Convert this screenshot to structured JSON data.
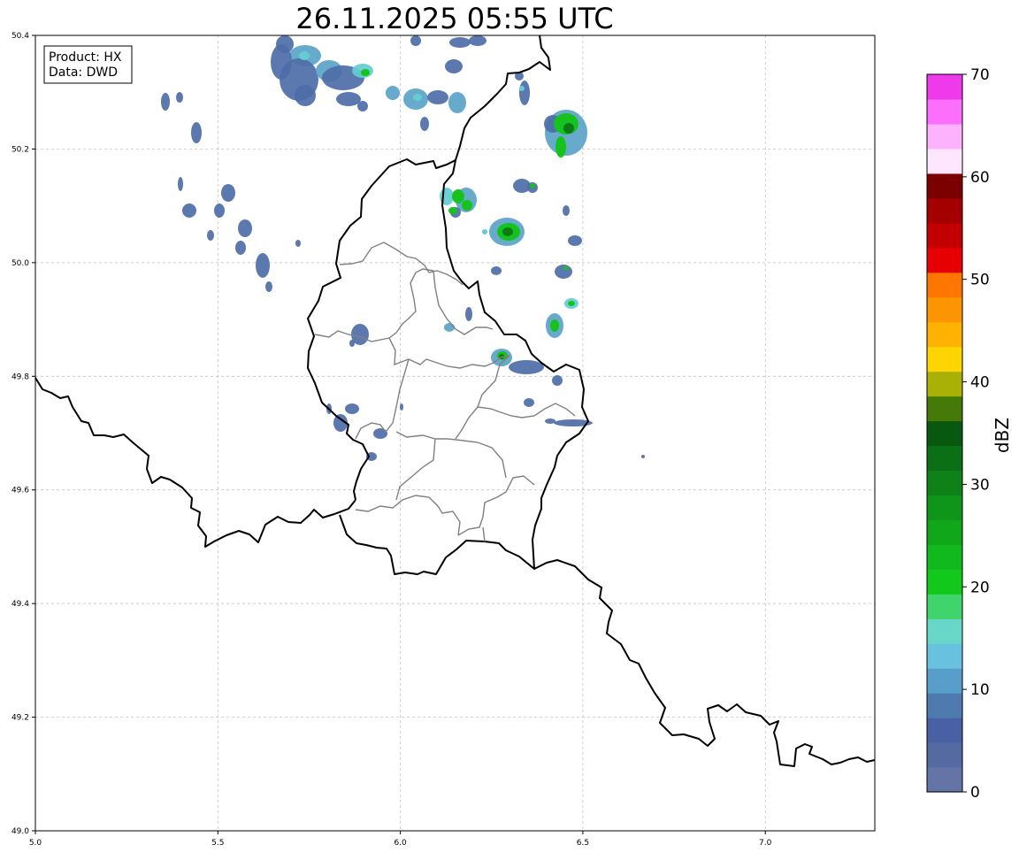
{
  "title": "26.11.2025 05:55 UTC",
  "info": {
    "product": "Product: HX",
    "source": "Data: DWD"
  },
  "x_ticks": [
    "5.0",
    "5.5",
    "6.0",
    "6.5",
    "7.0"
  ],
  "y_ticks": [
    "50.4",
    "50.2",
    "50.0",
    "49.8",
    "49.6",
    "49.4",
    "49.2",
    "49.0"
  ],
  "colorbar": {
    "label": "dBZ",
    "ticks": [
      "0",
      "10",
      "20",
      "30",
      "40",
      "50",
      "60",
      "70"
    ],
    "colors": [
      "#6474a6",
      "#566aa2",
      "#4961a4",
      "#4e7ab0",
      "#579fca",
      "#67c1df",
      "#68d7c9",
      "#3fd46c",
      "#12c91b",
      "#10b91c",
      "#10a81a",
      "#0f951a",
      "#0e8218",
      "#0b7015",
      "#085810",
      "#457a08",
      "#aab106",
      "#fed502",
      "#fdb202",
      "#fc9502",
      "#fd7700",
      "#e60003",
      "#c20001",
      "#a50000",
      "#7b0000",
      "#fde6fe",
      "#fcb2fd",
      "#fc6ffd",
      "#ee3aeb"
    ]
  },
  "map": {
    "lon_range": [
      5.0,
      7.3
    ],
    "lat_range": [
      49.0,
      50.4
    ],
    "grid": true,
    "radar_colors": {
      "weak": "#4e6ea8",
      "light": "#5aa3c8",
      "cyan": "#63cdd1",
      "green": "#16c21d",
      "dark_green": "#0d7a18"
    }
  }
}
